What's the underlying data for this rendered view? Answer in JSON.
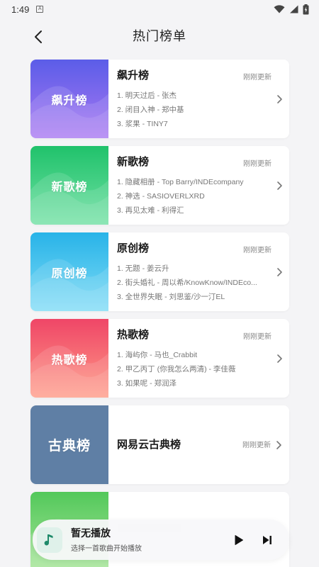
{
  "status_bar": {
    "time": "1:49",
    "notification_icon": "A"
  },
  "header": {
    "title": "热门榜单",
    "back_icon": "chevron-left-icon"
  },
  "charts": [
    {
      "cover_label": "飙升榜",
      "name": "飙升榜",
      "updated": "刚刚更新",
      "colors": [
        "#5b5de8",
        "#a978f2"
      ],
      "tracks": [
        "1. 明天过后 - 张杰",
        "2. 闭目入神 - 郑中基",
        "3. 浆果 - TINY7"
      ]
    },
    {
      "cover_label": "新歌榜",
      "name": "新歌榜",
      "updated": "刚刚更新",
      "colors": [
        "#20c26b",
        "#6fe0a3"
      ],
      "tracks": [
        "1. 隐藏相册 - Top Barry/INDEcompany",
        "2. 神选 - SASIOVERLXRD",
        "3. 再见太难 - 利得汇"
      ]
    },
    {
      "cover_label": "原创榜",
      "name": "原创榜",
      "updated": "刚刚更新",
      "colors": [
        "#28b3e8",
        "#7fdcf6"
      ],
      "tracks": [
        "1. 无题 - 姜云升",
        "2. 街头婚礼 - 周以希/KnowKnow/INDEco...",
        "3. 全世界失眠 - 刘思鉴/沙一汀EL"
      ]
    },
    {
      "cover_label": "热歌榜",
      "name": "热歌榜",
      "updated": "刚刚更新",
      "colors": [
        "#ef4667",
        "#ff9a86"
      ],
      "tracks": [
        "1. 海屿你 - 马也_Crabbit",
        "2. 甲乙丙丁 (你我怎么两清) - 李佳薇",
        "3. 如果呢 - 郑润泽"
      ]
    },
    {
      "cover_label": "古典榜",
      "name": "网易云古典榜",
      "updated": "刚刚更新",
      "colors": [
        "#5f7fa5",
        "#7f9aba"
      ],
      "tracks": []
    }
  ],
  "partial_chart": {
    "colors": [
      "#52c85a",
      "#a9e69b"
    ]
  },
  "player": {
    "title": "暂无播放",
    "subtitle": "选择一首歌曲开始播放",
    "cover_icon": "music-note-icon",
    "accent": "#1f8a6a"
  }
}
